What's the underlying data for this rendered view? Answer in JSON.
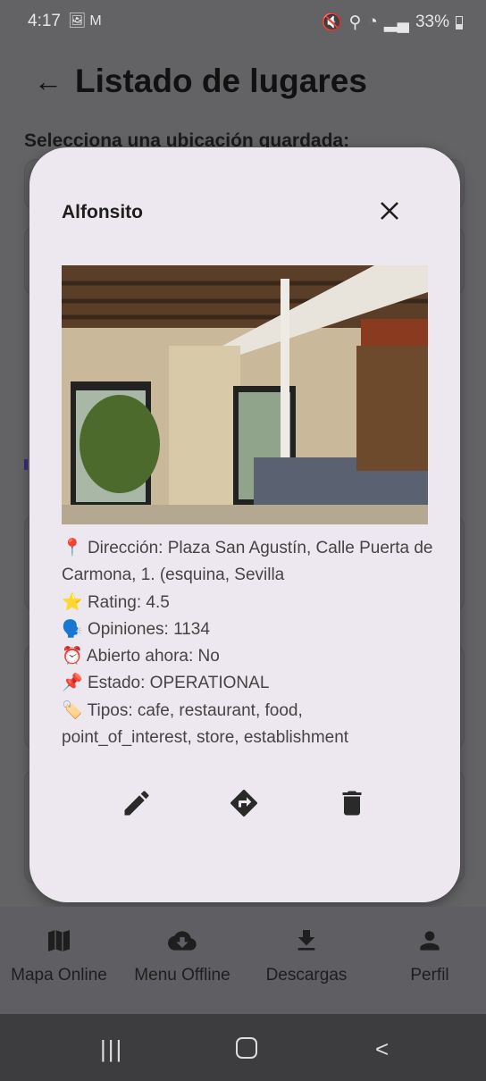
{
  "status_bar": {
    "time": "4:17",
    "battery": "33%"
  },
  "header": {
    "title": "Listado de lugares",
    "subtitle": "Selecciona una ubicación guardada:"
  },
  "dialog": {
    "title": "Alfonsito",
    "lines": [
      {
        "icon": "📍",
        "text": "Dirección: Plaza San Agustín, Calle Puerta de Carmona, 1. (esquina, Sevilla"
      },
      {
        "icon": "⭐",
        "text": "Rating: 4.5"
      },
      {
        "icon": "🗣️",
        "text": "Opiniones: 1134"
      },
      {
        "icon": "⏰",
        "text": "Abierto ahora: No"
      },
      {
        "icon": "📌",
        "text": "Estado: OPERATIONAL"
      },
      {
        "icon": "🏷️",
        "text": "Tipos: cafe, restaurant, food, point_of_interest, store, establishment"
      }
    ]
  },
  "bottom_nav": [
    {
      "label": "Mapa Online",
      "icon": "map-icon"
    },
    {
      "label": "Menu Offline",
      "icon": "cloud-download-icon"
    },
    {
      "label": "Descargas",
      "icon": "download-icon"
    },
    {
      "label": "Perfil",
      "icon": "person-icon"
    }
  ]
}
